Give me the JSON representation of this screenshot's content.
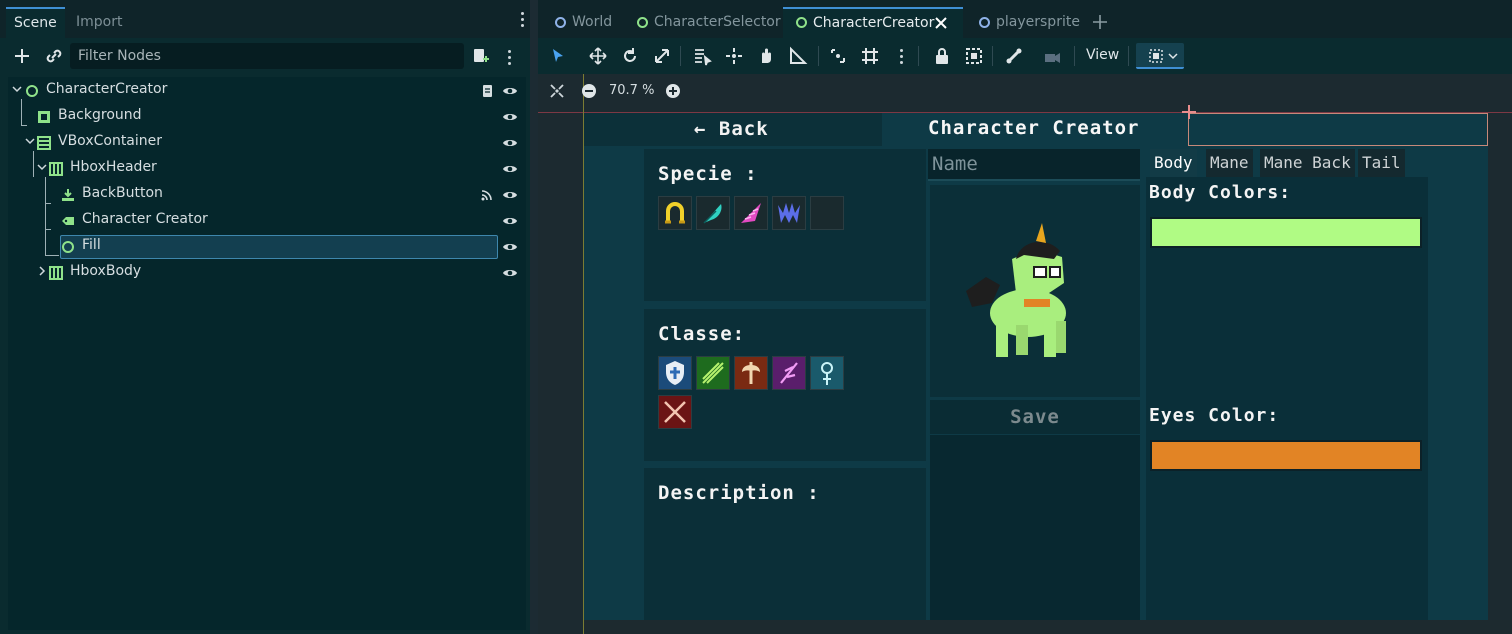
{
  "dock": {
    "tabs": [
      {
        "label": "Scene"
      },
      {
        "label": "Import"
      }
    ],
    "filter_placeholder": "Filter Nodes",
    "tree": [
      {
        "label": "CharacterCreator"
      },
      {
        "label": "Background"
      },
      {
        "label": "VBoxContainer"
      },
      {
        "label": "HboxHeader"
      },
      {
        "label": "BackButton"
      },
      {
        "label": "Character Creator"
      },
      {
        "label": "Fill"
      },
      {
        "label": "HboxBody"
      }
    ]
  },
  "editor": {
    "tabs": [
      {
        "label": "World"
      },
      {
        "label": "CharacterSelector"
      },
      {
        "label": "CharacterCreator"
      },
      {
        "label": "playersprite"
      }
    ],
    "view_label": "View",
    "zoom": "70.7 %"
  },
  "game": {
    "back_label": "← Back",
    "title": "Character Creator",
    "specie_title": "Specie :",
    "classe_title": "Classe:",
    "description_title": "Description :",
    "name_placeholder": "Name",
    "save_label": "Save",
    "right_tabs": [
      {
        "label": "Body"
      },
      {
        "label": "Mane"
      },
      {
        "label": "Mane Back"
      },
      {
        "label": "Tail"
      }
    ],
    "body_colors_label": "Body Colors:",
    "eyes_color_label": "Eyes Color:",
    "body_color": "#b0fb84",
    "eyes_color": "#e28425"
  },
  "colors": {
    "accent": "#3f8fd4",
    "node_green": "#8fe28a"
  }
}
